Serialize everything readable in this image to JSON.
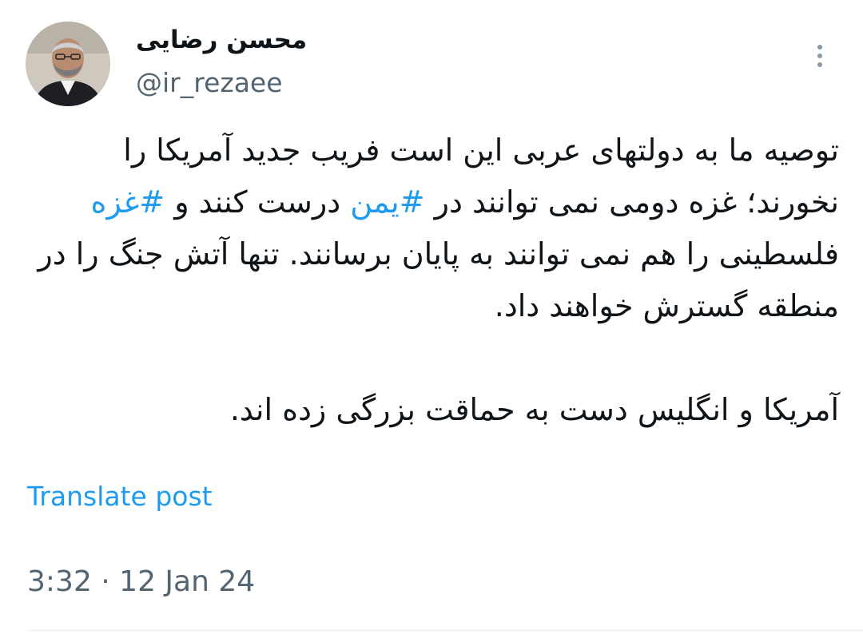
{
  "author": {
    "display_name": "محسن رضایی",
    "handle": "@ir_rezaee"
  },
  "post": {
    "paragraph1": {
      "part1": "توصیه ما به دولتهای عربی این است فریب جدید آمریکا را نخورند؛ غزه دومی نمی توانند در ",
      "hashtag1": "#یمن",
      "part2": " درست کنند و ",
      "hashtag2": "#غزه",
      "part3": " فلسطینی را هم نمی توانند به پایان برسانند. تنها آتش جنگ را در منطقه گسترش خواهند داد."
    },
    "paragraph2": "آمریکا و انگلیس دست به حماقت بزرگی زده اند.",
    "translate_label": "Translate post",
    "timestamp": "3:32 · 12 Jan 24"
  },
  "colors": {
    "link": "#1d9bf0",
    "secondary_text": "#536471",
    "text": "#0f1419"
  },
  "icons": {
    "more": "more-vertical-icon"
  }
}
